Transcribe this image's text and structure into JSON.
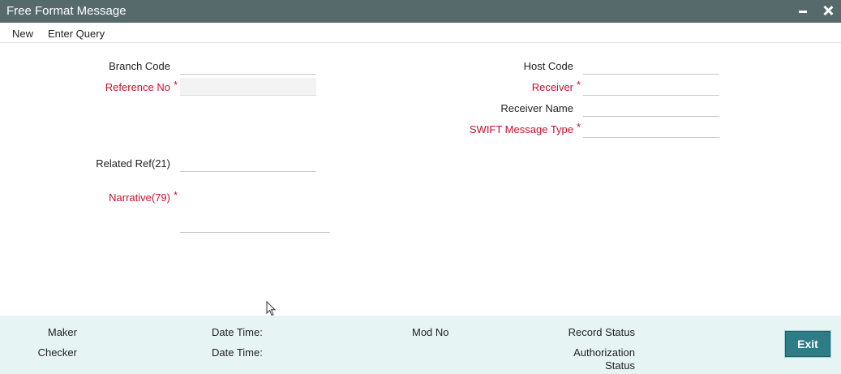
{
  "window": {
    "title": "Free Format Message",
    "minimize_icon": "minimize-icon",
    "close_icon": "close-icon"
  },
  "menu": {
    "new_label": "New",
    "enter_query_label": "Enter Query"
  },
  "form": {
    "branch_code_label": "Branch Code",
    "branch_code_value": "",
    "reference_no_label": "Reference No",
    "reference_no_value": "",
    "related_ref_label": "Related Ref(21)",
    "related_ref_value": "",
    "narrative_label": "Narrative(79)",
    "narrative_value": "",
    "host_code_label": "Host Code",
    "host_code_value": "",
    "receiver_label": "Receiver",
    "receiver_value": "",
    "receiver_name_label": "Receiver Name",
    "receiver_name_value": "",
    "swift_message_type_label": "SWIFT Message Type",
    "swift_message_type_value": "",
    "required_marker": "*"
  },
  "footer": {
    "maker_label": "Maker",
    "checker_label": "Checker",
    "maker_date_time_label": "Date Time:",
    "checker_date_time_label": "Date Time:",
    "mod_no_label": "Mod No",
    "record_status_label": "Record Status",
    "authorization_status_label_line1": "Authorization",
    "authorization_status_label_line2": "Status",
    "exit_label": "Exit"
  },
  "colors": {
    "titlebar": "#56696b",
    "required_label": "#c8102e",
    "footer_bg": "#e7f4f4",
    "exit_button": "#2e7c86"
  }
}
